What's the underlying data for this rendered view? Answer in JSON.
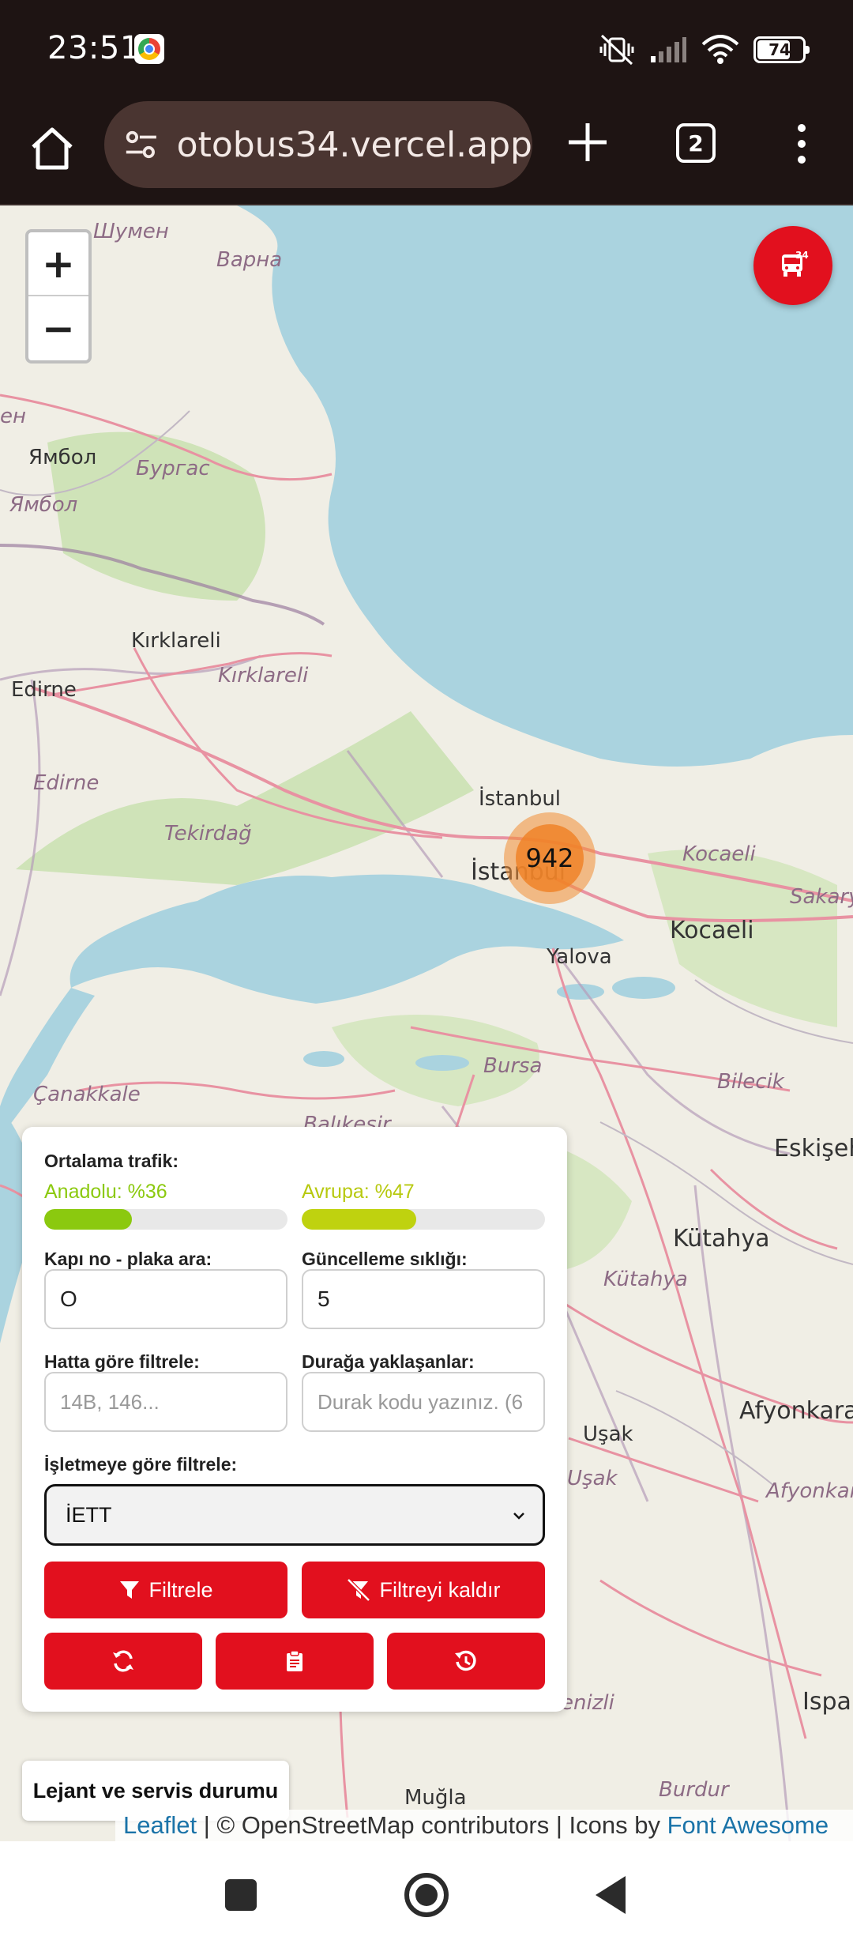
{
  "status_bar": {
    "time": "23:51",
    "battery": "74",
    "battery_level": 0.74,
    "icons": [
      "chrome-icon",
      "mute-vibrate-icon",
      "signal-icon",
      "wifi-icon",
      "battery-icon"
    ]
  },
  "browser": {
    "url": "otobus34.vercel.app",
    "tab_count": "2",
    "icons": [
      "home-icon",
      "site-settings-icon",
      "new-tab-icon",
      "tab-switcher-icon",
      "overflow-menu-icon"
    ]
  },
  "map": {
    "zoom_in": "+",
    "zoom_out": "−",
    "bus_badge": "34",
    "cluster_count": "942",
    "labels": {
      "shumen": "Шумен",
      "varna": "Варна",
      "en": "ен",
      "yambol1": "Ямбол",
      "burgas": "Бургас",
      "yambol2": "Ямбол",
      "kirklareli1": "Kırklareli",
      "kirklareli2": "Kırklareli",
      "edirne1": "Edirne",
      "edirne2": "Edirne",
      "tekirdag": "Tekirdağ",
      "istanbul1": "İstanbul",
      "istanbul2": "İstanbul",
      "kocaeli1": "Kocaeli",
      "kocaeli2": "Kocaeli",
      "sakarya": "Sakary",
      "yalova": "Yalova",
      "bursa": "Bursa",
      "canakkale": "Çanakkale",
      "balikesir": "Balıkesir",
      "bilecik": "Bilecik",
      "eskisehir": "Eskişeh",
      "kutahya1": "Kütahya",
      "kutahya2": "Kütahya",
      "afyonkarahisar1": "Afyonkara",
      "afyonkarahisar2": "Afyonkar",
      "usak1": "Uşak",
      "usak2": "Uşak",
      "denizli": "Denizli",
      "isparta": "Ispar",
      "burdur": "Burdur",
      "mugla": "Muğla"
    }
  },
  "panel": {
    "traffic_label": "Ortalama trafik:",
    "anadolu_label": "Anadolu: %36",
    "anadolu_value": 36,
    "anadolu_color": "#8bc90f",
    "avrupa_label": "Avrupa: %47",
    "avrupa_value": 47,
    "avrupa_color": "#bfd20f",
    "kapi_label": "Kapı no - plaka ara:",
    "kapi_value": "O",
    "guncelleme_label": "Güncelleme sıklığı:",
    "guncelleme_value": "5",
    "hat_label": "Hatta göre filtrele:",
    "hat_placeholder": "14B, 146...",
    "durak_label": "Durağa yaklaşanlar:",
    "durak_placeholder": "Durak kodu yazınız. (6",
    "isletme_label": "İşletmeye göre filtrele:",
    "isletme_value": "İETT",
    "filtrele_button": "Filtrele",
    "filtreyi_kaldir_button": "Filtreyi kaldır",
    "icon_buttons": [
      "refresh-icon",
      "clipboard-icon",
      "history-icon"
    ],
    "accent_color": "#e2101e"
  },
  "legend_button": "Lejant ve servis durumu",
  "attribution": {
    "leaflet": "Leaflet",
    "sep1": " | © OpenStreetMap contributors | Icons by ",
    "fontawesome": "Font Awesome"
  },
  "nav_bar": {
    "icons": [
      "recents-icon",
      "home-nav-icon",
      "back-icon"
    ]
  }
}
